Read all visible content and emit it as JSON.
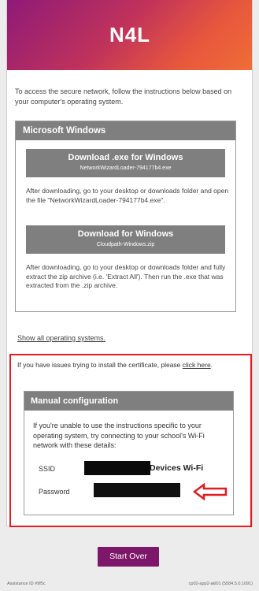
{
  "logo": {
    "text": "N4L"
  },
  "intro_text": "To access the secure network, follow the instructions below based on your computer's operating system.",
  "os_section": {
    "title": "Microsoft Windows",
    "download_exe": {
      "label": "Download .exe for Windows",
      "file": "NetworkWizardLoader-794177b4.exe"
    },
    "exe_instructions": "After downloading, go to your desktop or downloads folder and open the file \"NetworkWizardLoader-794177b4.exe\".",
    "download_zip": {
      "label": "Download for Windows",
      "file": "Cloudpath-Windows.zip"
    },
    "zip_instructions": "After downloading, go to your desktop or downloads folder and fully extract the zip archive (i.e. 'Extract All'). Then run the .exe that was extracted from the .zip archive."
  },
  "show_all_link": "Show all operating systems.",
  "issue_text": "If you have issues trying to install the certificate, please ",
  "issue_link": "click here",
  "issue_end": ".",
  "manual": {
    "title": "Manual configuration",
    "text": "If you're unable to use the instructions specific to your operating system, try connecting to your school's Wi-Fi network with these details:",
    "ssid_label": "SSID",
    "ssid_suffix": "Devices Wi-Fi",
    "password_label": "Password"
  },
  "start_over": "Start Over",
  "footer": {
    "left": "Assistance ID #9f5c",
    "right": "cp02-app2-akl01 (5584.5.0.1091)"
  },
  "colors": {
    "accent": "#7c1769",
    "highlight": "#e21b23",
    "panel": "#7f7f7f"
  }
}
